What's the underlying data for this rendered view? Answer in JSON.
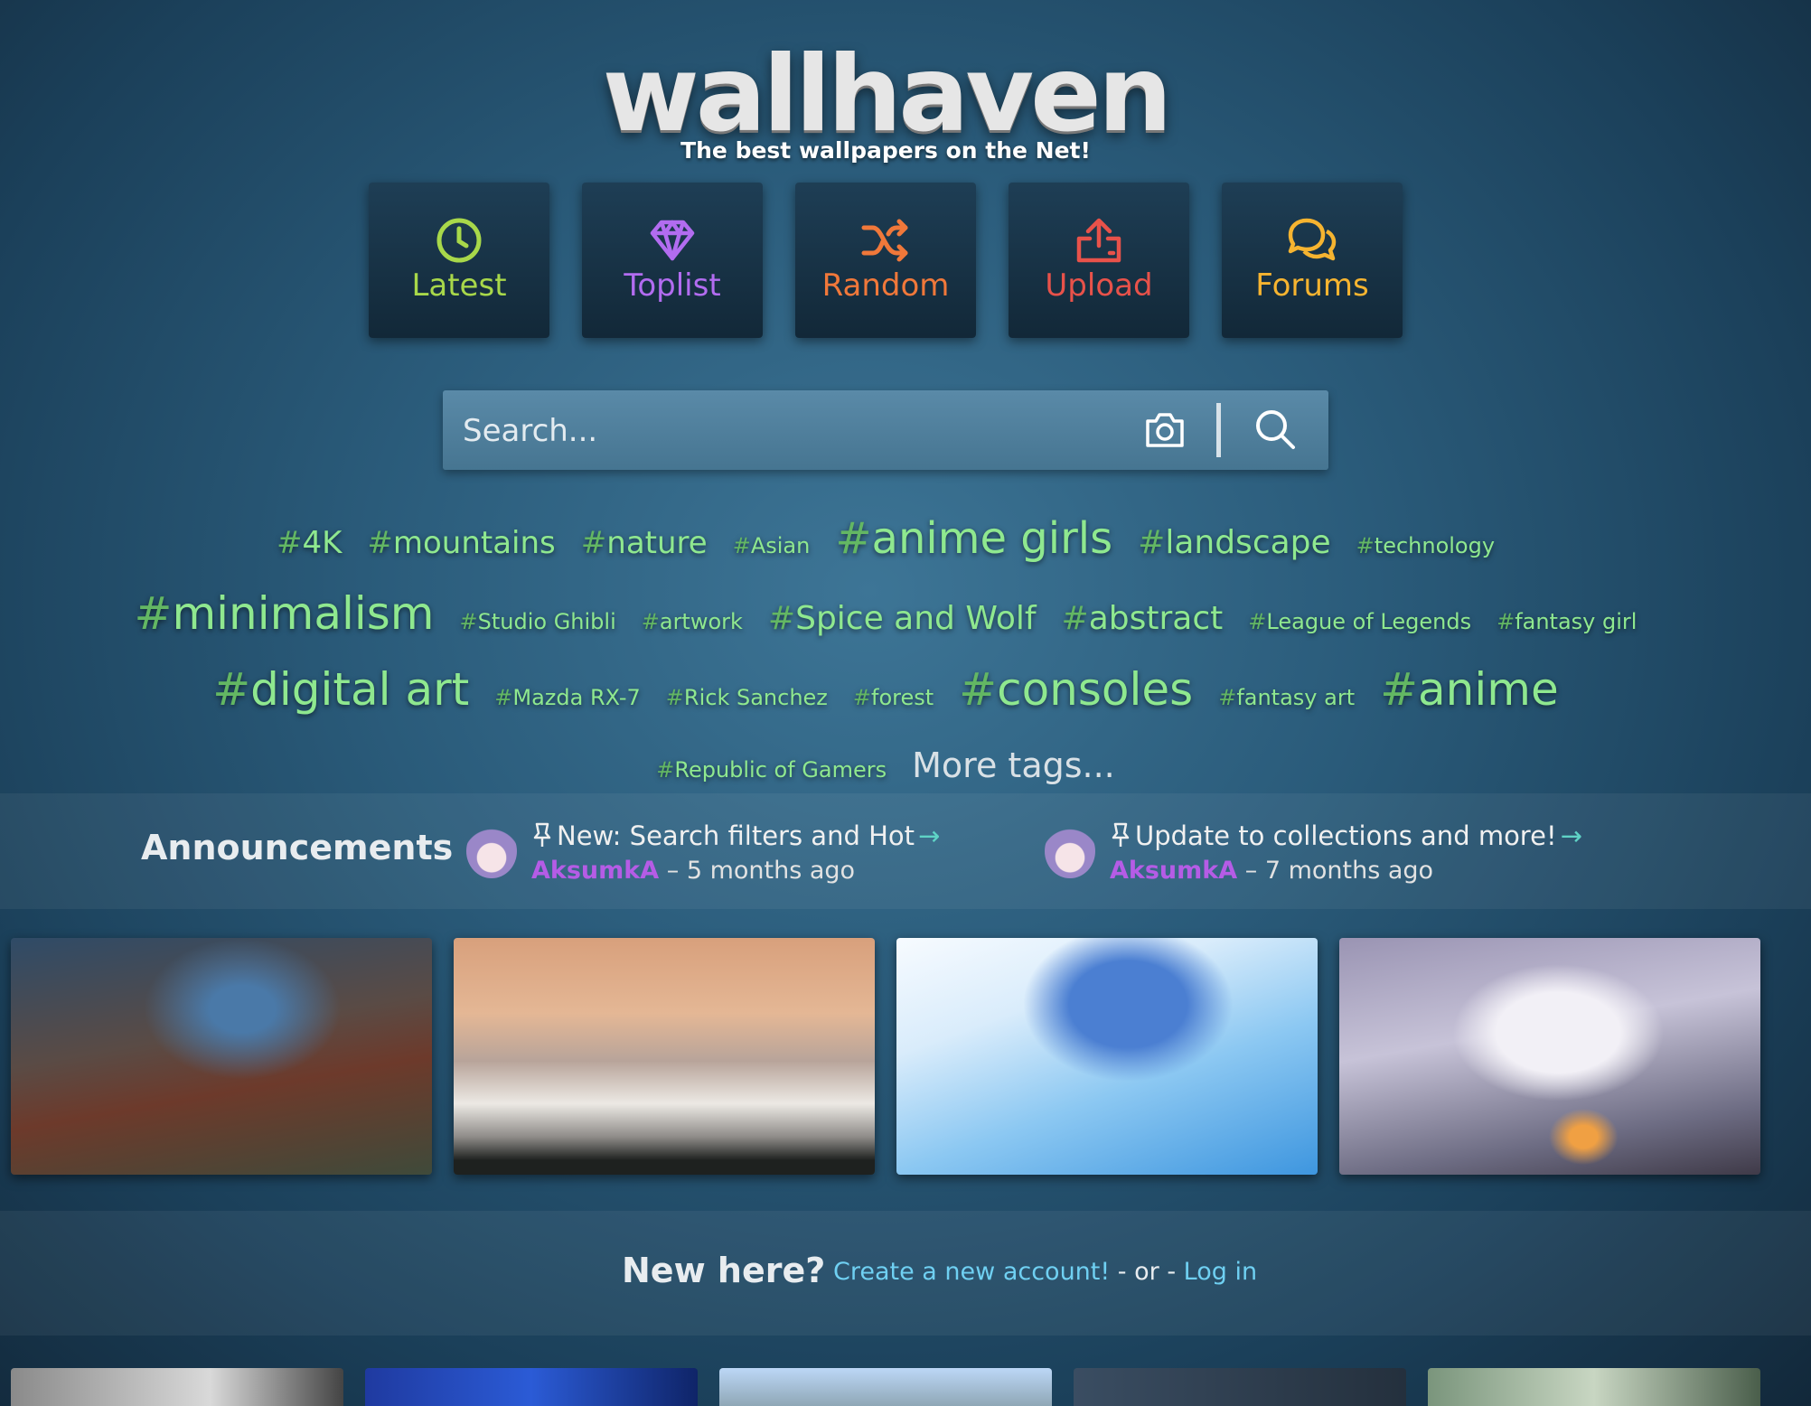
{
  "header": {
    "logo": "wallhaven",
    "tagline": "The best wallpapers on the Net!"
  },
  "nav": [
    {
      "label": "Latest",
      "icon": "clock-icon",
      "color": "#a8d84a"
    },
    {
      "label": "Toplist",
      "icon": "diamond-icon",
      "color": "#b26cf0"
    },
    {
      "label": "Random",
      "icon": "shuffle-icon",
      "color": "#f0783a"
    },
    {
      "label": "Upload",
      "icon": "upload-icon",
      "color": "#e8524a"
    },
    {
      "label": "Forums",
      "icon": "chat-icon",
      "color": "#f6b430"
    }
  ],
  "search": {
    "placeholder": "Search...",
    "camera_icon": "camera-icon",
    "search_icon": "magnifier-icon"
  },
  "tags": {
    "items": [
      {
        "name": "4K",
        "size": 34
      },
      {
        "name": "mountains",
        "size": 34
      },
      {
        "name": "nature",
        "size": 34
      },
      {
        "name": "Asian",
        "size": 24
      },
      {
        "name": "anime girls",
        "size": 48
      },
      {
        "name": "landscape",
        "size": 36
      },
      {
        "name": "technology",
        "size": 24
      },
      {
        "name": "minimalism",
        "size": 50
      },
      {
        "name": "Studio Ghibli",
        "size": 24
      },
      {
        "name": "artwork",
        "size": 24
      },
      {
        "name": "Spice and Wolf",
        "size": 36
      },
      {
        "name": "abstract",
        "size": 36
      },
      {
        "name": "League of Legends",
        "size": 24
      },
      {
        "name": "fantasy girl",
        "size": 24
      },
      {
        "name": "digital art",
        "size": 50
      },
      {
        "name": "Mazda RX-7",
        "size": 24
      },
      {
        "name": "Rick Sanchez",
        "size": 24
      },
      {
        "name": "forest",
        "size": 24
      },
      {
        "name": "consoles",
        "size": 50
      },
      {
        "name": "fantasy art",
        "size": 24
      },
      {
        "name": "anime",
        "size": 50
      },
      {
        "name": "Republic of Gamers",
        "size": 24
      }
    ],
    "hash": "#",
    "more_label": "More tags..."
  },
  "announcements": {
    "title": "Announcements",
    "items": [
      {
        "title": "New: Search filters and Hot",
        "author": "AksumkA",
        "separator": "–",
        "time": "5 months ago",
        "arrow": "→"
      },
      {
        "title": "Update to collections and more!",
        "author": "AksumkA",
        "separator": "–",
        "time": "7 months ago",
        "arrow": "→"
      }
    ]
  },
  "thumbnails": [
    "landscape-painting",
    "sea-of-clouds",
    "anime-girl-water",
    "snow-fox-campfire"
  ],
  "new_here": {
    "title": "New here?",
    "create_label": "Create a new account!",
    "or_label": "- or -",
    "login_label": "Log in"
  },
  "colors": {
    "tag_green": "#8fe88f",
    "tag_hash": "#63b763",
    "link": "#6fd0f2",
    "author": "#b55ce6",
    "accent_arrow": "#5fd3c6"
  }
}
